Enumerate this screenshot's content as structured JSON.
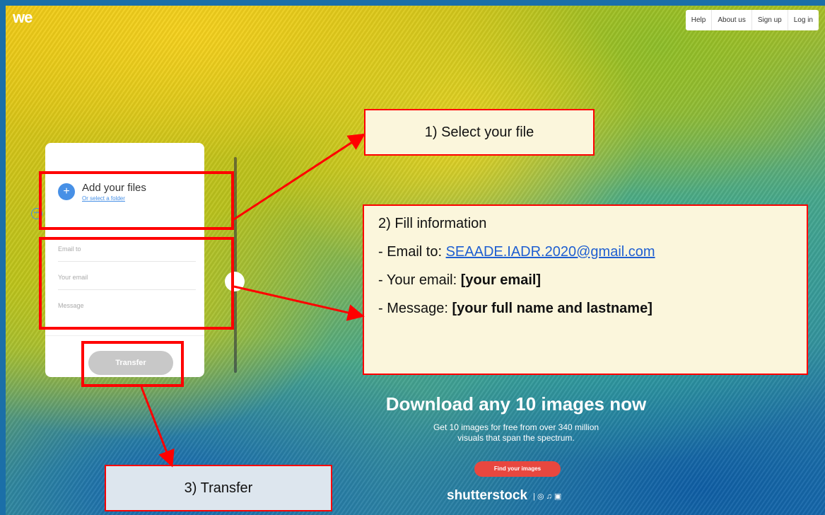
{
  "logo": "we",
  "nav": {
    "items": [
      "Help",
      "About us",
      "Sign up",
      "Log in"
    ]
  },
  "panel": {
    "add_title": "Add your files",
    "add_subtitle": "Or select a folder",
    "email_to_placeholder": "Email to",
    "your_email_placeholder": "Your email",
    "message_placeholder": "Message",
    "more_icon": "ellipsis-circle-icon",
    "transfer_label": "Transfer"
  },
  "callouts": {
    "step1": "1) Select your file",
    "step2_title": "2) Fill information",
    "step2_email_label": "- Email to: ",
    "step2_email_value": "SEAADE.IADR.2020@gmail.com",
    "step2_your_email_label": "- Your email: ",
    "step2_your_email_value": "[your email]",
    "step2_message_label": "- Message: ",
    "step2_message_value": "[your full name and lastname]",
    "step3": "3) Transfer"
  },
  "ad": {
    "title": "Download any 10 images now",
    "subtitle_line1": "Get 10 images for free from over 340 million",
    "subtitle_line2": "visuals that span the spectrum.",
    "button": "Find your images",
    "brand": "shutterstock",
    "brand_icons": "| ◎ ♫ ▣"
  },
  "colors": {
    "highlight": "#ff0000",
    "accent": "#4790e6",
    "ad_button": "#e8473f"
  }
}
